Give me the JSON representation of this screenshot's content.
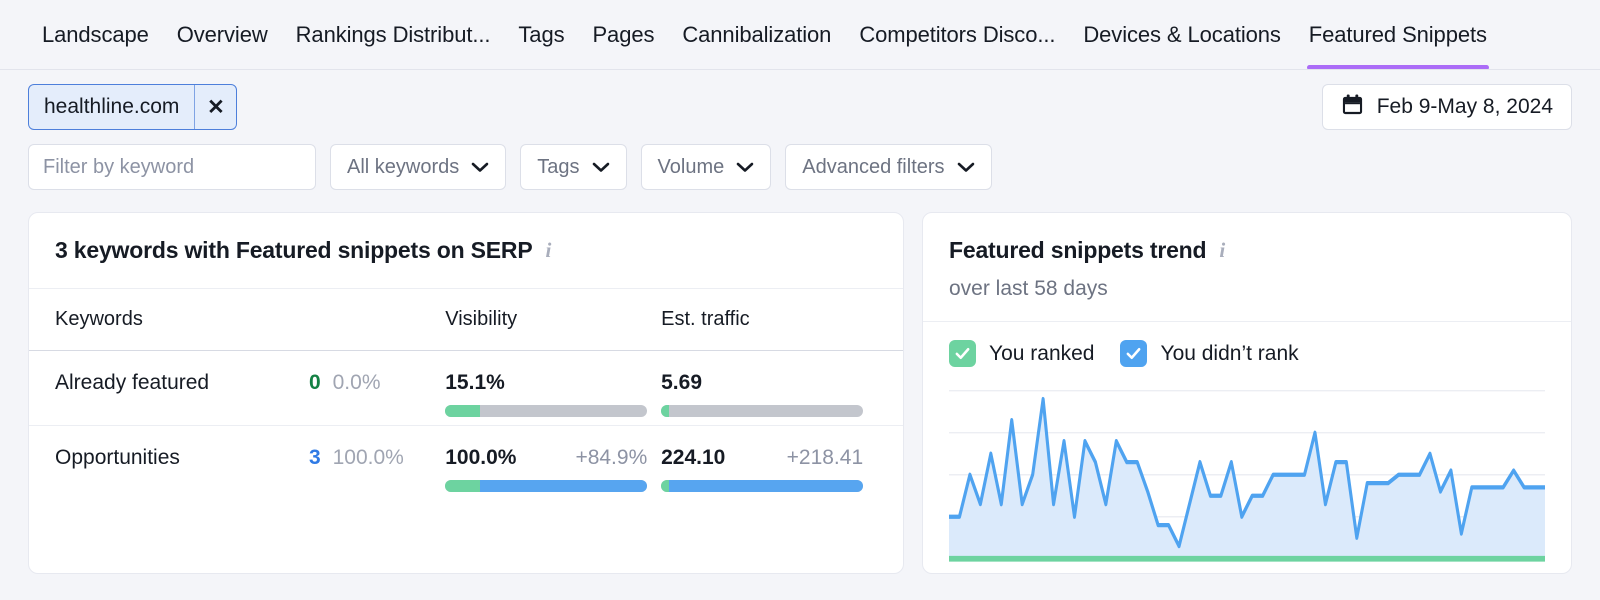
{
  "nav": {
    "tabs": [
      {
        "label": "Landscape",
        "active": false
      },
      {
        "label": "Overview",
        "active": false
      },
      {
        "label": "Rankings Distribut...",
        "active": false
      },
      {
        "label": "Tags",
        "active": false
      },
      {
        "label": "Pages",
        "active": false
      },
      {
        "label": "Cannibalization",
        "active": false
      },
      {
        "label": "Competitors Disco...",
        "active": false
      },
      {
        "label": "Devices & Locations",
        "active": false
      },
      {
        "label": "Featured Snippets",
        "active": true
      }
    ],
    "active_accent": "#ab6cf7"
  },
  "filters": {
    "domain_chip": {
      "label": "healthline.com",
      "close_label": "✕"
    },
    "search": {
      "value": "",
      "placeholder": "Filter by keyword",
      "icon": "search-icon"
    },
    "dropdowns": [
      {
        "label": "All keywords"
      },
      {
        "label": "Tags"
      },
      {
        "label": "Volume"
      },
      {
        "label": "Advanced filters"
      }
    ],
    "date_range": {
      "label": "Feb 9-May 8, 2024",
      "icon": "calendar-icon"
    }
  },
  "left_card": {
    "title": "3 keywords with Featured snippets on SERP",
    "info_icon": "info-icon",
    "columns": [
      "Keywords",
      "",
      "",
      "Visibility",
      "Est. traffic"
    ],
    "rows": [
      {
        "keyword": "Already featured",
        "count": "0",
        "count_color": "#148144",
        "share": "0.0%",
        "visibility": "15.1%",
        "visibility_delta": "",
        "visibility_green_pct": 17,
        "visibility_blue_pct": 0,
        "traffic": "5.69",
        "traffic_delta": "",
        "traffic_green_pct": 4,
        "traffic_blue_pct": 0
      },
      {
        "keyword": "Opportunities",
        "count": "3",
        "count_color": "#2f7ae5",
        "share": "100.0%",
        "visibility": "100.0%",
        "visibility_delta": "+84.9%",
        "visibility_green_pct": 17,
        "visibility_blue_pct": 83,
        "traffic": "224.10",
        "traffic_delta": "+218.41",
        "traffic_green_pct": 4,
        "traffic_blue_pct": 96
      }
    ]
  },
  "right_card": {
    "title": "Featured snippets trend",
    "info_icon": "info-icon",
    "subtitle": "over last 58 days",
    "legend": [
      {
        "label": "You ranked",
        "color": "#6dd3a0",
        "checked": true
      },
      {
        "label": "You didn’t rank",
        "color": "#4fa3f0",
        "checked": true
      }
    ]
  },
  "chart_data": {
    "type": "area",
    "title": "Featured snippets trend",
    "subtitle": "over last 58 days",
    "xlabel": "",
    "ylabel": "",
    "grid": true,
    "legend_position": "top-left",
    "x": [
      1,
      2,
      3,
      4,
      5,
      6,
      7,
      8,
      9,
      10,
      11,
      12,
      13,
      14,
      15,
      16,
      17,
      18,
      19,
      20,
      21,
      22,
      23,
      24,
      25,
      26,
      27,
      28,
      29,
      30,
      31,
      32,
      33,
      34,
      35,
      36,
      37,
      38,
      39,
      40,
      41,
      42,
      43,
      44,
      45,
      46,
      47,
      48,
      49,
      50,
      51,
      52,
      53,
      54,
      55,
      56,
      57,
      58
    ],
    "series": [
      {
        "name": "You didn’t rank",
        "color": "#4fa3f0",
        "values": [
          2,
          2,
          4,
          2.6,
          5,
          2.6,
          6.6,
          2.6,
          4,
          7.6,
          2.6,
          5.6,
          2,
          5.6,
          4.6,
          2.6,
          5.6,
          4.6,
          4.6,
          3.2,
          1.6,
          1.6,
          0.6,
          2.6,
          4.6,
          3,
          3,
          4.6,
          2,
          3,
          3,
          4,
          4,
          4,
          4,
          6,
          2.6,
          4.6,
          4.6,
          1,
          3.6,
          3.6,
          3.6,
          4,
          4,
          4,
          5,
          3.2,
          4.2,
          1.2,
          3.4,
          3.4,
          3.4,
          3.4,
          4.2,
          3.4,
          3.4,
          3.4
        ]
      },
      {
        "name": "You ranked",
        "color": "#6dd3a0",
        "values": [
          0,
          0,
          0,
          0,
          0,
          0,
          0,
          0,
          0,
          0,
          0,
          0,
          0,
          0,
          0,
          0,
          0,
          0,
          0,
          0,
          0,
          0,
          0,
          0,
          0,
          0,
          0,
          0,
          0,
          0,
          0,
          0,
          0,
          0,
          0,
          0,
          0,
          0,
          0,
          0,
          0,
          0,
          0,
          0,
          0,
          0,
          0,
          0,
          0,
          0,
          0,
          0,
          0,
          0,
          0,
          0,
          0,
          0
        ]
      }
    ],
    "ylim": [
      0,
      8
    ]
  }
}
